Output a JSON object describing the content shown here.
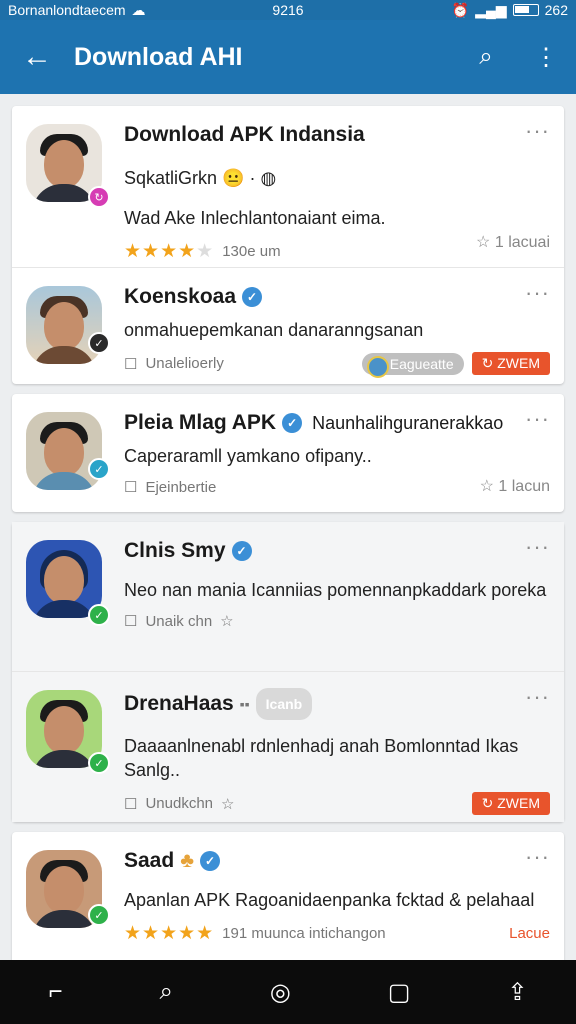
{
  "status": {
    "left": "Bornanlondtaecem",
    "time": "9216",
    "right": "262"
  },
  "appbar": {
    "title": "Download AHI"
  },
  "feed": [
    {
      "name": "Download APK Indansia",
      "line1": "SqkatliGrkn",
      "line2": "Wad Ake Inlechlantonaiant eima.",
      "rating": 4,
      "count": "130e um",
      "right": "1 lacuai",
      "badge_color": "#d63cb4"
    },
    {
      "name": "Koenskoaa",
      "line1": "onmahuepemkanan danaranngsanan",
      "meta": "Unalelioerly",
      "pill_gray": "Eagueatte",
      "pill_red": "ZWEM",
      "badge_color": "#2a2a2a"
    },
    {
      "name": "Pleia Mlag APK",
      "extra": "Naunhalihguranerakkao",
      "line1": "Caperaramll yamkano ofipany..",
      "meta": "Ejeinbertie",
      "right": "1 lacun",
      "badge_color": "#2aa4c9"
    },
    {
      "name": "Clnis Smy",
      "line1": "Neo nan mania Icanniias pomennanpkaddark poreka",
      "meta": "Unaik chn",
      "badge_color": "#2eb14a"
    },
    {
      "name": "DrenaHaas",
      "chip": "Icanb",
      "line1": "Daaaanlnenabl rdnlenhadj anah Bomlonntad Ikas Sanlg..",
      "meta": "Unudkchn",
      "pill_red": "ZWEM",
      "badge_color": "#2eb14a"
    },
    {
      "name": "Saad",
      "line1": "Apanlan APK Ragoanidaenpanka fcktad & pelahaal",
      "meta": "191 muunca intichangon",
      "rating": 5,
      "right": "Lacue",
      "badge_color": "#2eb14a"
    }
  ]
}
